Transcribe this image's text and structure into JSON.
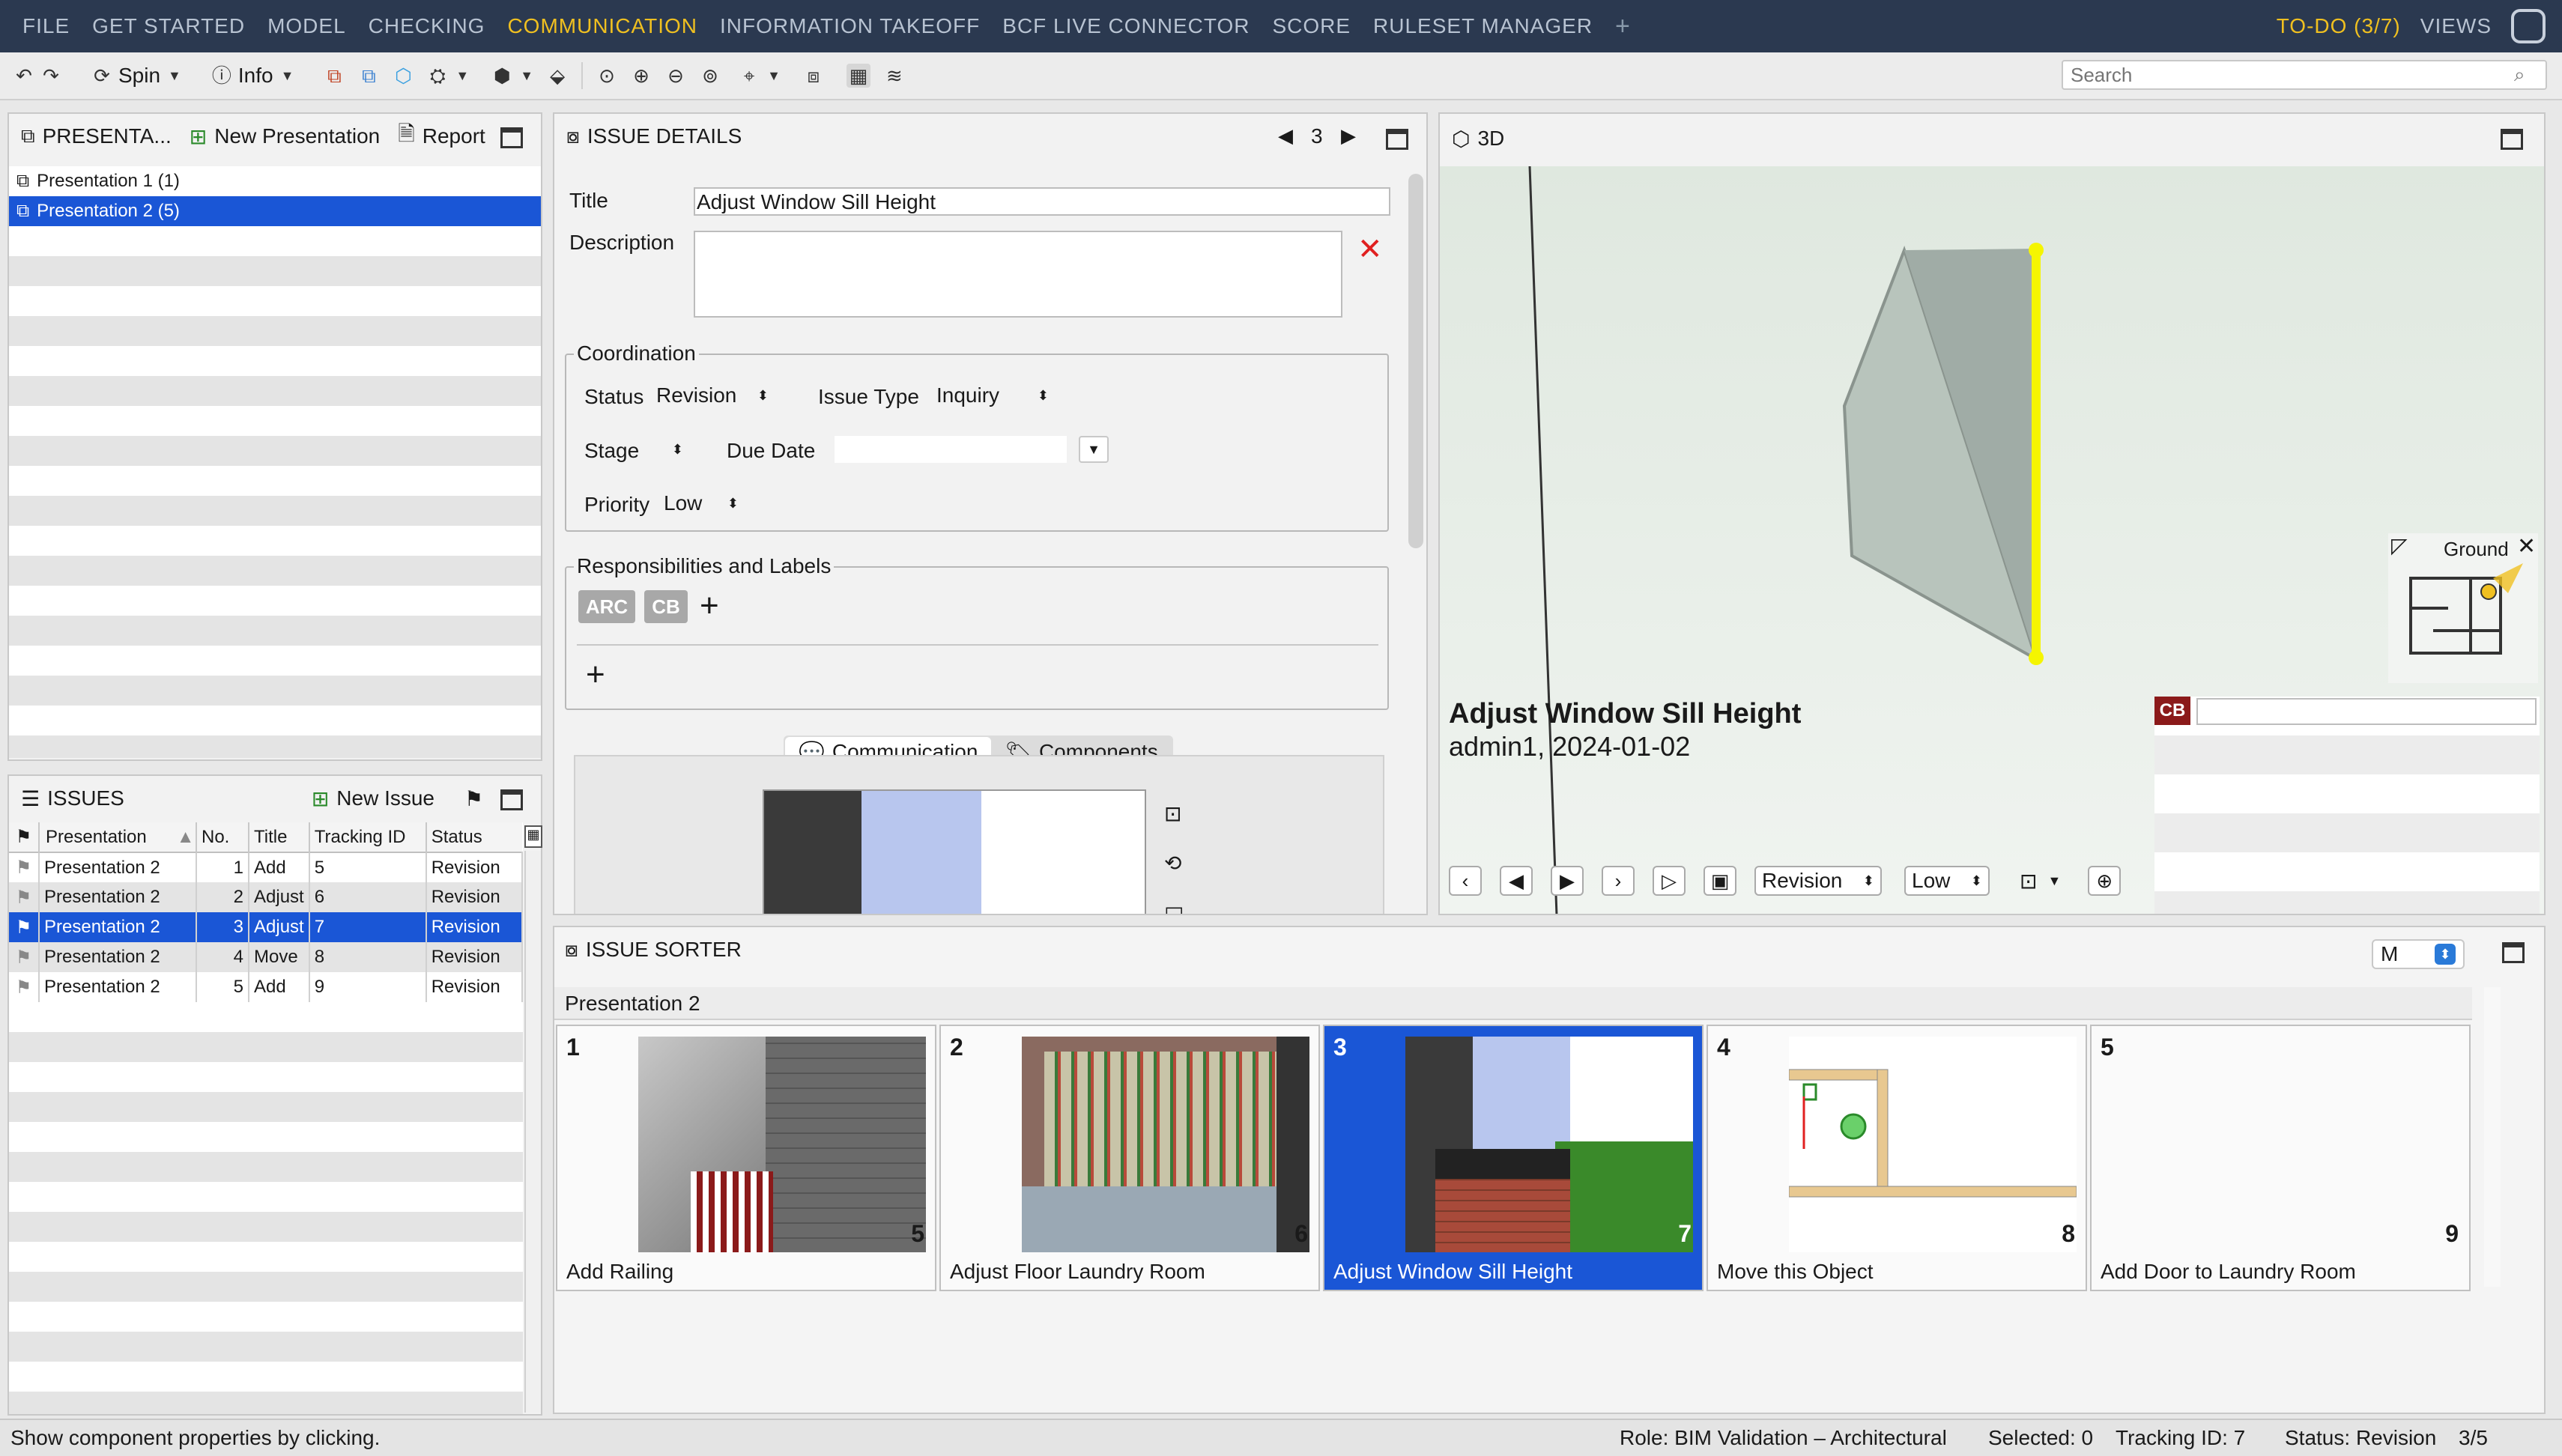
{
  "menu": {
    "items": [
      "FILE",
      "GET STARTED",
      "MODEL",
      "CHECKING",
      "COMMUNICATION",
      "INFORMATION TAKEOFF",
      "BCF LIVE CONNECTOR",
      "SCORE",
      "RULESET MANAGER"
    ],
    "active": "COMMUNICATION",
    "plus": "+",
    "todo": "TO-DO (3/7)",
    "views": "VIEWS"
  },
  "toolbar": {
    "spin": "Spin",
    "info": "Info",
    "search_placeholder": "Search"
  },
  "presentations": {
    "header": "PRESENTA...",
    "new_label": "New Presentation",
    "report_label": "Report",
    "items": [
      "Presentation 1 (1)",
      "Presentation 2 (5)"
    ],
    "selected_index": 1
  },
  "issues": {
    "header": "ISSUES",
    "new_label": "New Issue",
    "columns": [
      "Presentation",
      "No.",
      "Title",
      "Tracking ID",
      "Status"
    ],
    "rows": [
      {
        "presentation": "Presentation 2",
        "no": "1",
        "title": "Add",
        "tracking": "5",
        "status": "Revision"
      },
      {
        "presentation": "Presentation 2",
        "no": "2",
        "title": "Adjust",
        "tracking": "6",
        "status": "Revision"
      },
      {
        "presentation": "Presentation 2",
        "no": "3",
        "title": "Adjust",
        "tracking": "7",
        "status": "Revision"
      },
      {
        "presentation": "Presentation 2",
        "no": "4",
        "title": "Move",
        "tracking": "8",
        "status": "Revision"
      },
      {
        "presentation": "Presentation 2",
        "no": "5",
        "title": "Add",
        "tracking": "9",
        "status": "Revision"
      }
    ],
    "selected_index": 2
  },
  "details": {
    "header": "ISSUE DETAILS",
    "page": "3",
    "title_label": "Title",
    "title_value": "Adjust Window Sill Height",
    "description_label": "Description",
    "description_value": "",
    "coordination_label": "Coordination",
    "status_label": "Status",
    "status_value": "Revision",
    "issue_type_label": "Issue Type",
    "issue_type_value": "Inquiry",
    "stage_label": "Stage",
    "stage_value": "",
    "due_date_label": "Due Date",
    "due_date_value": "",
    "priority_label": "Priority",
    "priority_value": "Low",
    "responsibilities_label": "Responsibilities and Labels",
    "tags": [
      "ARC",
      "CB"
    ],
    "plus": "+",
    "tab_communication": "Communication",
    "tab_components": "Components"
  },
  "view3d": {
    "header": "3D",
    "issue_title": "Adjust Window Sill Height",
    "issue_meta": "admin1, 2024-01-02",
    "minimap_label": "Ground",
    "status_value": "Revision",
    "priority_value": "Low",
    "comment_user": "CB",
    "comment_value": ""
  },
  "sorter": {
    "header": "ISSUE SORTER",
    "size_value": "M",
    "group": "Presentation 2",
    "cards": [
      {
        "num": "1",
        "tracking": "5",
        "title": "Add Railing"
      },
      {
        "num": "2",
        "tracking": "6",
        "title": "Adjust Floor Laundry Room"
      },
      {
        "num": "3",
        "tracking": "7",
        "title": "Adjust Window Sill Height"
      },
      {
        "num": "4",
        "tracking": "8",
        "title": "Move this Object"
      },
      {
        "num": "5",
        "tracking": "9",
        "title": "Add Door to Laundry Room"
      }
    ],
    "selected_index": 2
  },
  "status": {
    "hint": "Show component properties by clicking.",
    "role": "Role: BIM Validation – Architectural",
    "selected": "Selected: 0",
    "tracking": "Tracking ID: 7",
    "status": "Status: Revision",
    "position": "3/5"
  },
  "colors": {
    "menubar": "#2b3950",
    "accent": "#f0c020",
    "selection": "#1a56d6",
    "highlight_edge": "#f5f500",
    "delete": "#e02020",
    "cb_tag": "#8b1a1a"
  }
}
